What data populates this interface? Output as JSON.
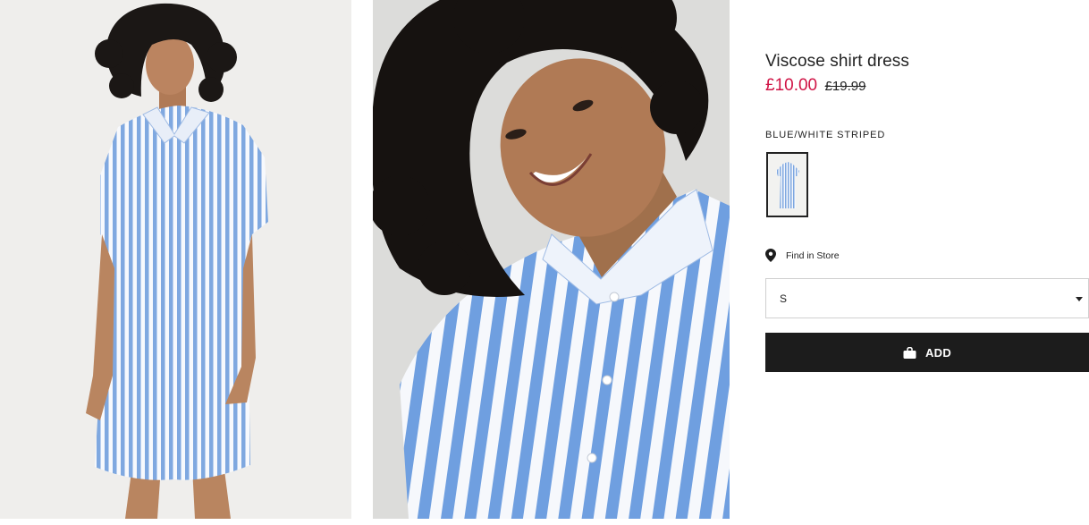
{
  "product": {
    "title": "Viscose shirt dress",
    "price_now": "£10.00",
    "price_was": "£19.99"
  },
  "color": {
    "name": "BLUE/WHITE STRIPED"
  },
  "store": {
    "label": "Find in Store",
    "icon": "location-pin-icon"
  },
  "size_selector": {
    "selected": "S",
    "icon": "caret-down-icon"
  },
  "add_button": {
    "label": "ADD",
    "icon": "shopping-bag-icon"
  },
  "colors": {
    "sale_red": "#d01345",
    "button_black": "#1c1c1c",
    "stripe_blue": "#7fa8e0"
  }
}
